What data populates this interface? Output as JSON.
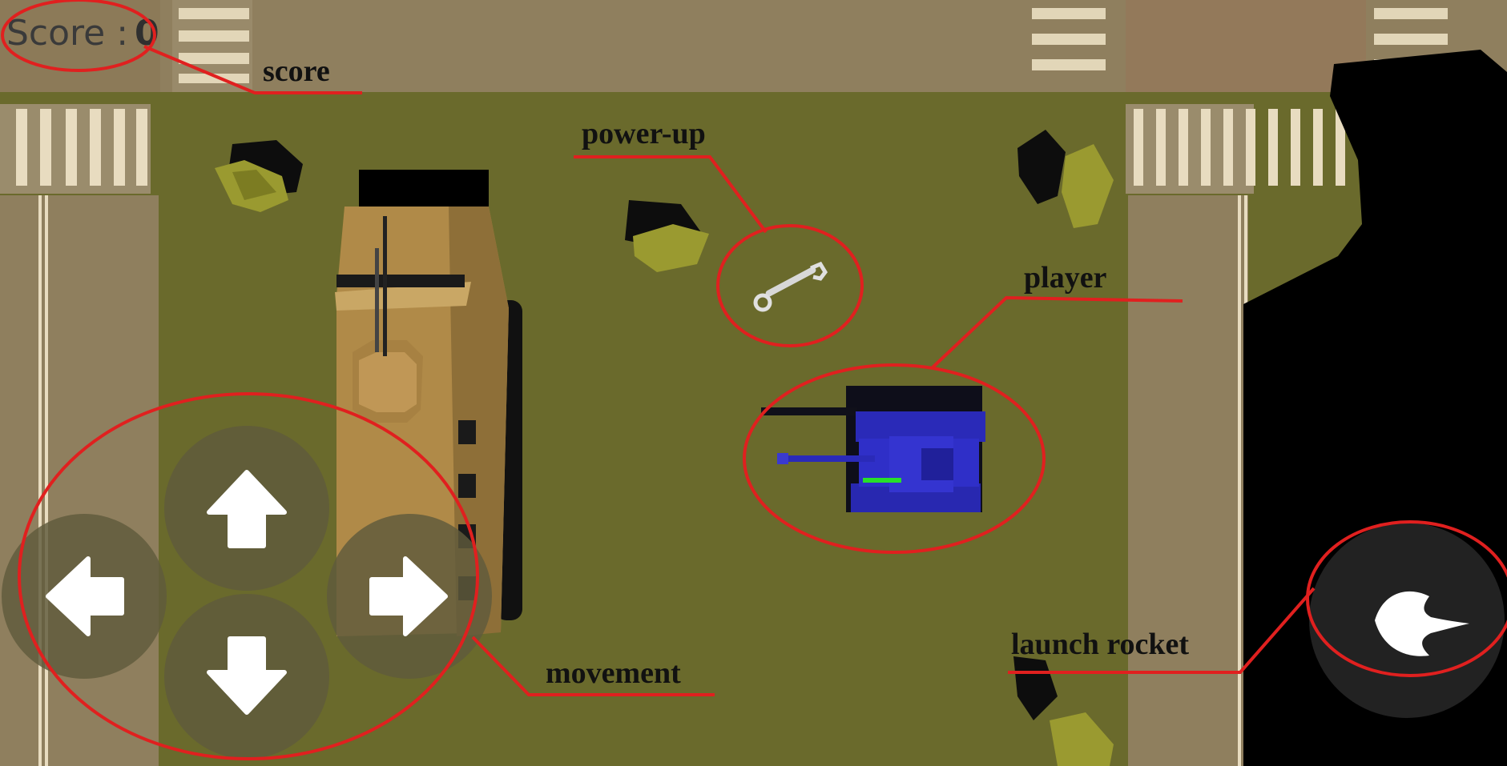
{
  "hud": {
    "score_label": "Score :",
    "score_value": "0"
  },
  "annotations": {
    "score": "score",
    "power_up": "power-up",
    "player": "player",
    "movement": "movement",
    "launch_rocket": "launch rocket"
  },
  "controls": {
    "up_icon": "arrow-up-icon",
    "down_icon": "arrow-down-icon",
    "left_icon": "arrow-left-icon",
    "right_icon": "arrow-right-icon",
    "rocket_icon": "rocket-icon"
  },
  "colors": {
    "grass": "#6a6a2c",
    "sidewalk": "#8f7f5e",
    "annotation_red": "#e0201f",
    "player_tank": "#2a2ab8",
    "enemy_vehicle": "#b08a48",
    "health_bar": "#27e02a"
  }
}
